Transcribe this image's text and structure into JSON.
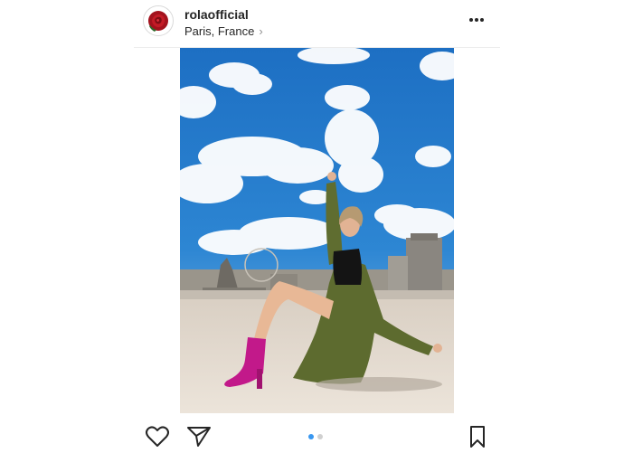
{
  "post": {
    "username": "rolaofficial",
    "location": "Paris, France",
    "carousel": {
      "total": 2,
      "active": 1
    }
  },
  "icons": {
    "avatar": "red-rose-avatar",
    "more": "more-horizontal-icon",
    "location_chevron": "chevron-right-icon",
    "like": "heart-icon",
    "share": "send-icon",
    "save": "bookmark-icon"
  },
  "colors": {
    "text": "#262626",
    "secondary": "#8e8e8e",
    "accent": "#3897f0",
    "boots": "#c2198a",
    "sky": "#1f72c4"
  }
}
